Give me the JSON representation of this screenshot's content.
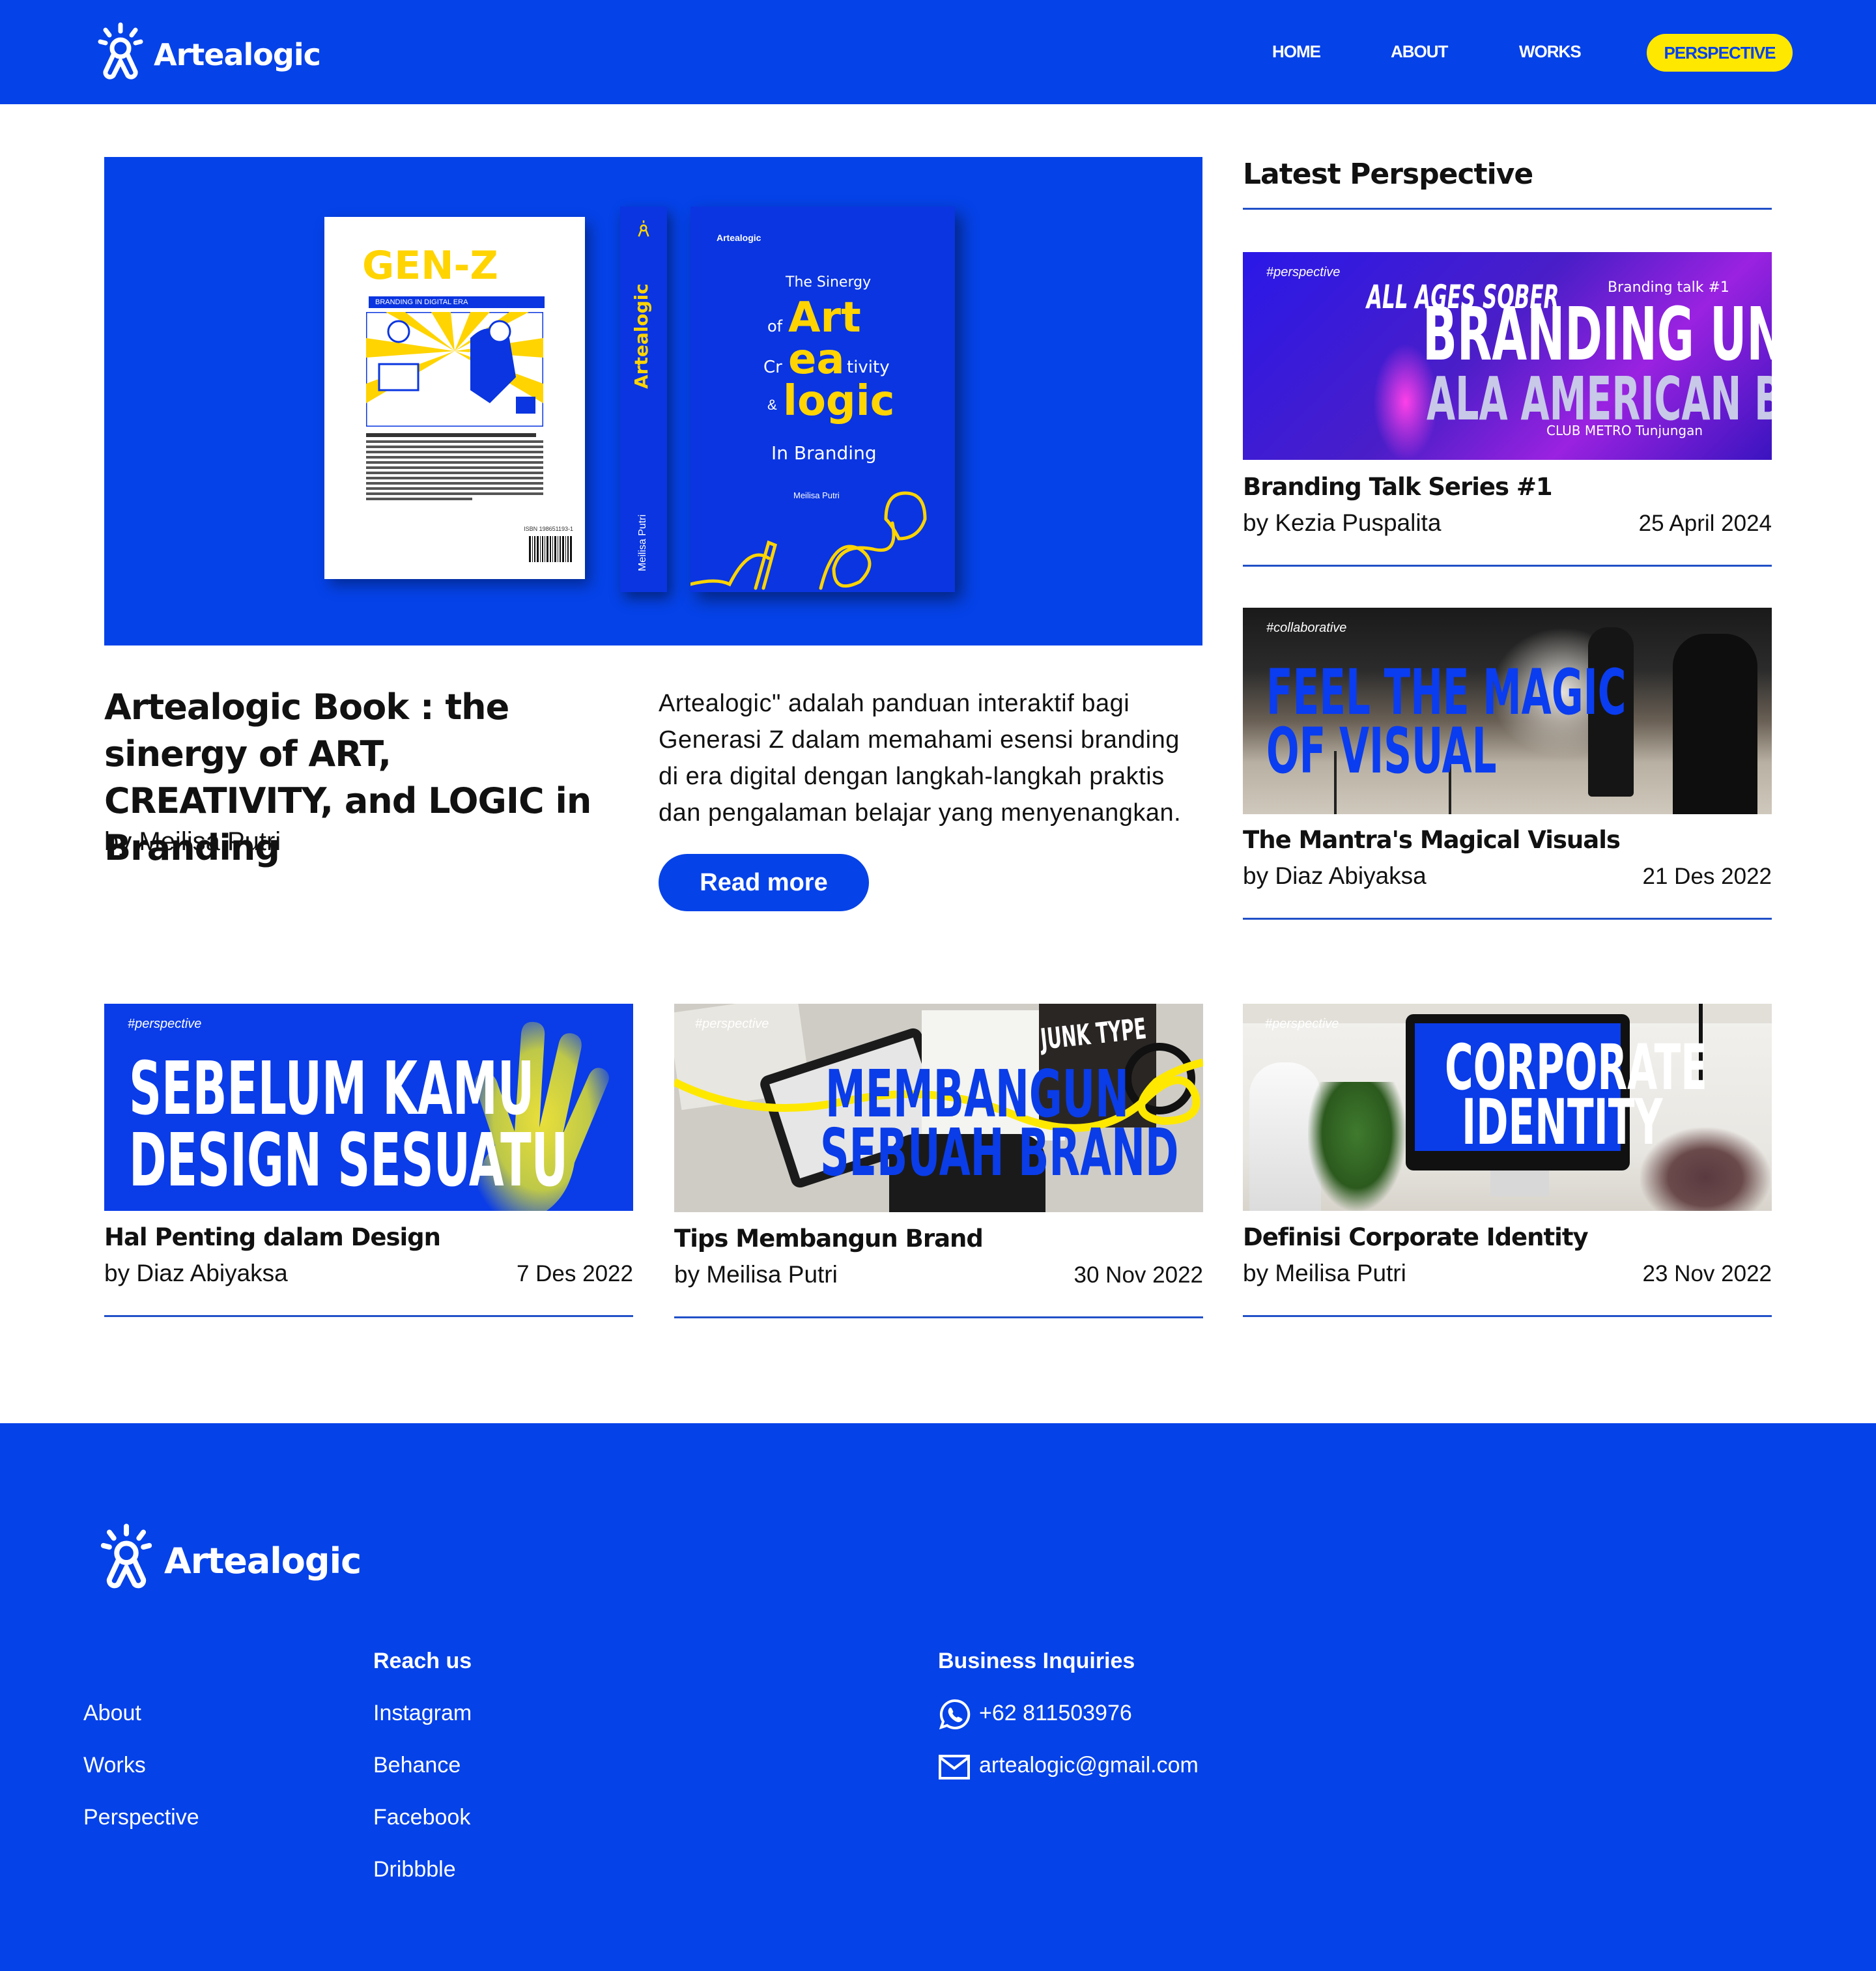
{
  "header": {
    "brand": "Artealogic",
    "nav": {
      "home": "HOME",
      "about": "ABOUT",
      "works": "WORKS",
      "perspective": "PERSPECTIVE"
    }
  },
  "hero": {
    "title": "Artealogic Book : the sinergy of ART, CREATIVITY, and LOGIC in Branding",
    "author": "by Meilisa Putri",
    "description": "Artealogic\" adalah panduan interaktif bagi Generasi Z dalam memahami esensi branding di era digital dengan langkah-langkah praktis dan pengalaman belajar yang menyenangkan.",
    "read_more": "Read more",
    "book": {
      "back_title": "GEN-Z",
      "back_subtitle": "BRANDING IN DIGITAL ERA",
      "spine_brand": "Artealogic",
      "spine_author": "Meilisa Putri",
      "front_brand": "Artealogic",
      "front_line1": "The Sinergy",
      "front_of": "of",
      "front_art": "Art",
      "front_cr": "Cr",
      "front_ea": "ea",
      "front_tivity": "tivity",
      "front_amp": "&",
      "front_logic": "logic",
      "front_in": "In Branding",
      "front_author": "Meilisa Putri",
      "isbn": "ISBN 198651193-1"
    }
  },
  "sidebar": {
    "title": "Latest Perspective",
    "cards": [
      {
        "tag": "#perspective",
        "poster_line0": "ALL AGES SOBER",
        "poster_line1": "BRANDING UNIK",
        "poster_line2": "ALA AMERICAN BAR",
        "poster_small": "Branding talk #1",
        "poster_sub": "CLUB METRO Tunjungan",
        "title": "Branding Talk Series #1",
        "author": "by Kezia Puspalita",
        "date": "25 April 2024"
      },
      {
        "tag": "#collaborative",
        "poster_line1": "FEEL THE MAGIC",
        "poster_line2": "OF VISUAL",
        "title": "The Mantra's Magical Visuals",
        "author": "by Diaz Abiyaksa",
        "date": "21 Des 2022"
      }
    ]
  },
  "grid": [
    {
      "tag": "#perspective",
      "poster_line1": "SEBELUM KAMU",
      "poster_line2": "DESIGN SESUATU",
      "title": "Hal Penting dalam Design",
      "author": "by Diaz Abiyaksa",
      "date": "7 Des 2022"
    },
    {
      "tag": "#perspective",
      "poster_line1": "MEMBANGUN",
      "poster_line2": "SEBUAH BRAND",
      "poster_sticker": "JUNK TYPE",
      "title": "Tips Membangun Brand",
      "author": "by Meilisa Putri",
      "date": "30 Nov 2022"
    },
    {
      "tag": "#perspective",
      "poster_line1": "CORPORATE",
      "poster_line2": "IDENTITY",
      "title": "Definisi Corporate Identity",
      "author": "by Meilisa Putri",
      "date": "23 Nov 2022"
    }
  ],
  "footer": {
    "brand": "Artealogic",
    "col1": [
      "About",
      "Works",
      "Perspective"
    ],
    "reach_title": "Reach us",
    "reach": [
      "Instagram",
      "Behance",
      "Facebook",
      "Dribbble"
    ],
    "business_title": "Business Inquiries",
    "phone": "+62 811503976",
    "email": "artealogic@gmail.com"
  },
  "colors": {
    "brand_blue": "#0542e8",
    "accent_yellow": "#ffe800",
    "rule_blue": "#2150c8"
  },
  "icons": {
    "logo": "person-lightbulb-icon",
    "phone": "whatsapp-icon",
    "email": "mail-icon"
  }
}
